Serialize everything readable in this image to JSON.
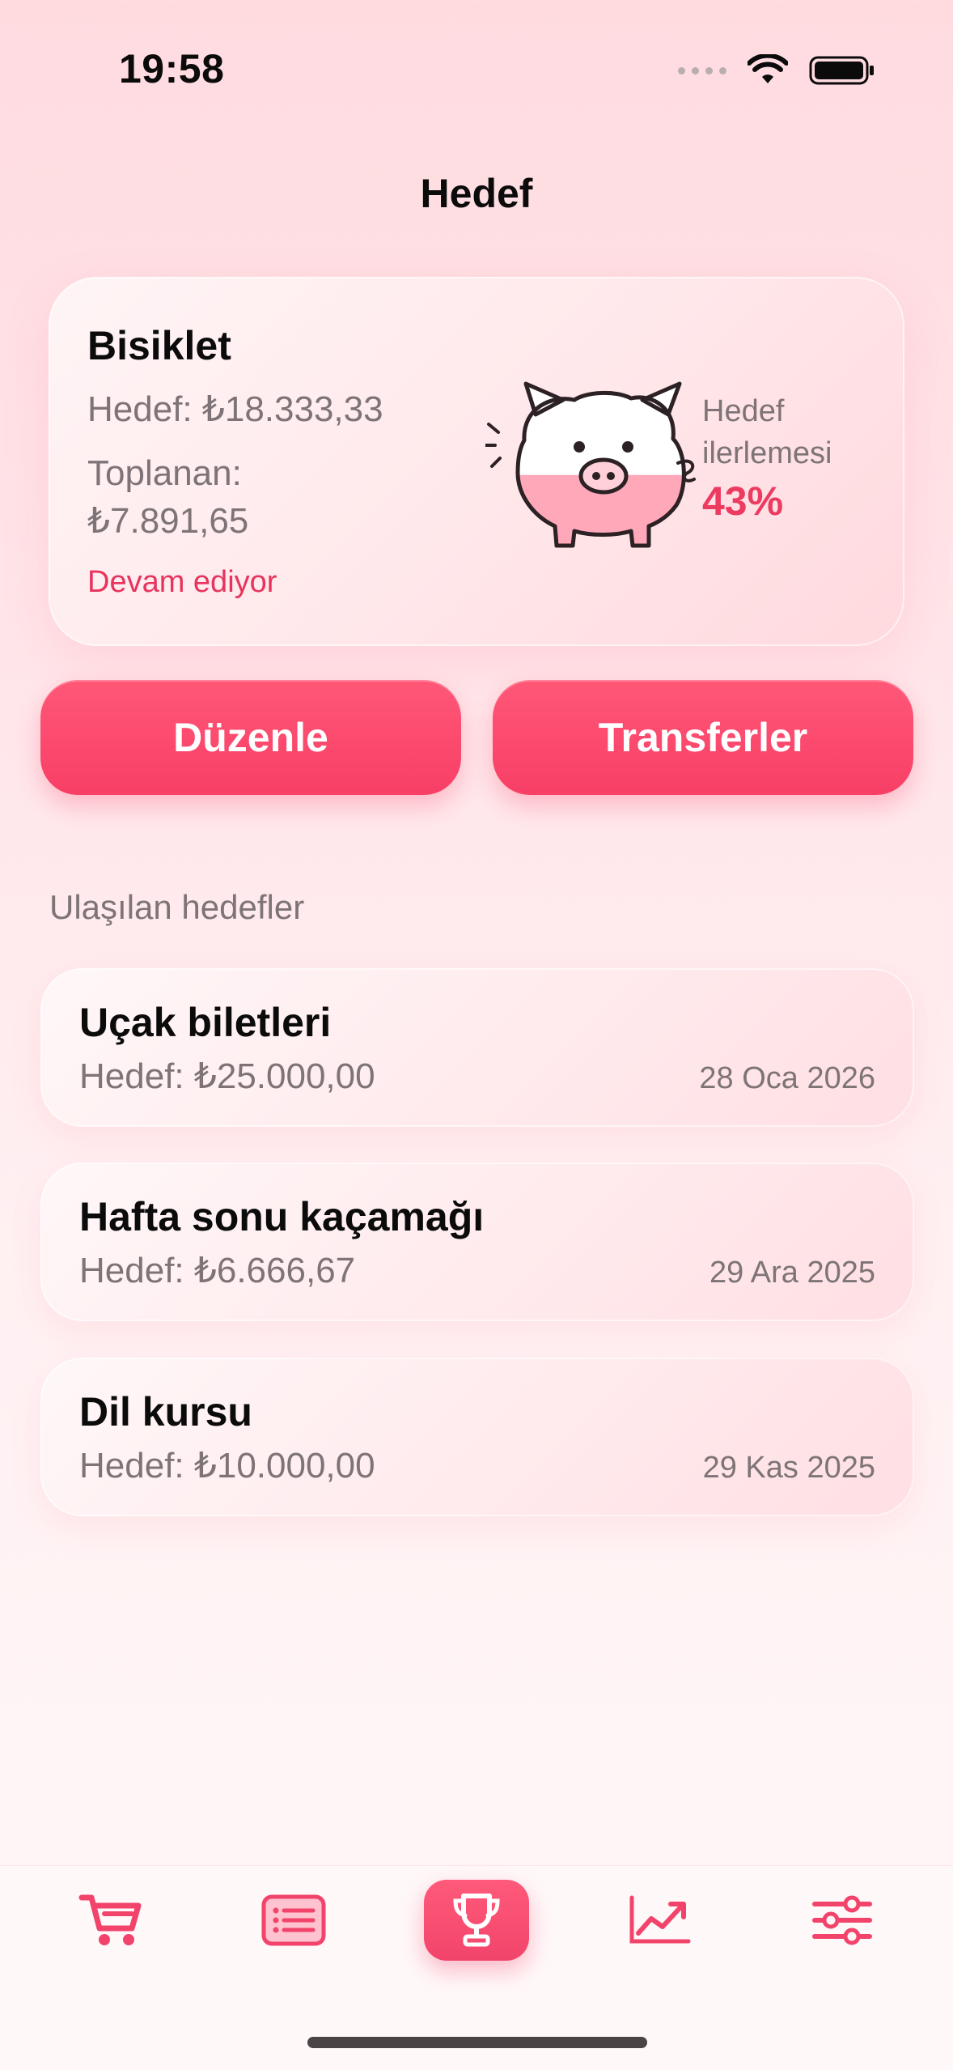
{
  "status_bar": {
    "time": "19:58"
  },
  "header": {
    "title": "Hedef"
  },
  "active_goal": {
    "name": "Bisiklet",
    "target": "Hedef: ₺18.333,33",
    "collected_label": "Toplanan:",
    "collected_value": "₺7.891,65",
    "status": "Devam ediyor",
    "progress_label": "Hedef ilerlemesi",
    "progress_text": "43%",
    "progress_fraction": 0.43
  },
  "actions": {
    "edit_label": "Düzenle",
    "transfers_label": "Transferler"
  },
  "completed": {
    "section_label": "Ulaşılan hedefler",
    "items": [
      {
        "name": "Uçak biletleri",
        "target": "Hedef: ₺25.000,00",
        "date": "28 Oca 2026"
      },
      {
        "name": "Hafta sonu kaçamağı",
        "target": "Hedef: ₺6.666,67",
        "date": "29 Ara 2025"
      },
      {
        "name": "Dil kursu",
        "target": "Hedef: ₺10.000,00",
        "date": "29 Kas 2025"
      }
    ]
  },
  "tab_bar": {
    "items": [
      {
        "icon": "cart-icon"
      },
      {
        "icon": "list-icon"
      },
      {
        "icon": "trophy-icon",
        "active": true
      },
      {
        "icon": "chart-line-icon"
      },
      {
        "icon": "sliders-icon"
      }
    ]
  },
  "colors": {
    "accent": "#f83f66",
    "progress_text": "#ec3a60",
    "secondary_text": "#7e7477",
    "piggy_fill": "#ffa8ba"
  }
}
